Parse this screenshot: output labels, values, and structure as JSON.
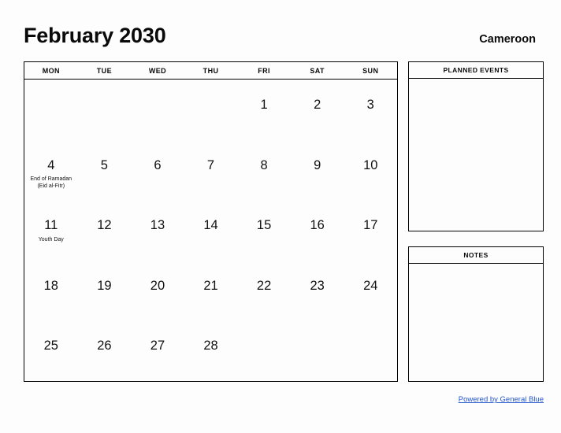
{
  "header": {
    "title": "February 2030",
    "country": "Cameroon"
  },
  "calendar": {
    "weekdays": [
      "MON",
      "TUE",
      "WED",
      "THU",
      "FRI",
      "SAT",
      "SUN"
    ],
    "weeks": [
      [
        {
          "day": "",
          "event": ""
        },
        {
          "day": "",
          "event": ""
        },
        {
          "day": "",
          "event": ""
        },
        {
          "day": "",
          "event": ""
        },
        {
          "day": "1",
          "event": ""
        },
        {
          "day": "2",
          "event": ""
        },
        {
          "day": "3",
          "event": ""
        }
      ],
      [
        {
          "day": "4",
          "event": "End of Ramadan (Eid al-Fitr)"
        },
        {
          "day": "5",
          "event": ""
        },
        {
          "day": "6",
          "event": ""
        },
        {
          "day": "7",
          "event": ""
        },
        {
          "day": "8",
          "event": ""
        },
        {
          "day": "9",
          "event": ""
        },
        {
          "day": "10",
          "event": ""
        }
      ],
      [
        {
          "day": "11",
          "event": "Youth Day"
        },
        {
          "day": "12",
          "event": ""
        },
        {
          "day": "13",
          "event": ""
        },
        {
          "day": "14",
          "event": ""
        },
        {
          "day": "15",
          "event": ""
        },
        {
          "day": "16",
          "event": ""
        },
        {
          "day": "17",
          "event": ""
        }
      ],
      [
        {
          "day": "18",
          "event": ""
        },
        {
          "day": "19",
          "event": ""
        },
        {
          "day": "20",
          "event": ""
        },
        {
          "day": "21",
          "event": ""
        },
        {
          "day": "22",
          "event": ""
        },
        {
          "day": "23",
          "event": ""
        },
        {
          "day": "24",
          "event": ""
        }
      ],
      [
        {
          "day": "25",
          "event": ""
        },
        {
          "day": "26",
          "event": ""
        },
        {
          "day": "27",
          "event": ""
        },
        {
          "day": "28",
          "event": ""
        },
        {
          "day": "",
          "event": ""
        },
        {
          "day": "",
          "event": ""
        },
        {
          "day": "",
          "event": ""
        }
      ]
    ]
  },
  "panels": {
    "planned_events_title": "PLANNED EVENTS",
    "planned_events_body": "",
    "notes_title": "NOTES",
    "notes_body": ""
  },
  "footer": {
    "link_label": "Powered by General Blue",
    "link_color": "#2255cc"
  }
}
